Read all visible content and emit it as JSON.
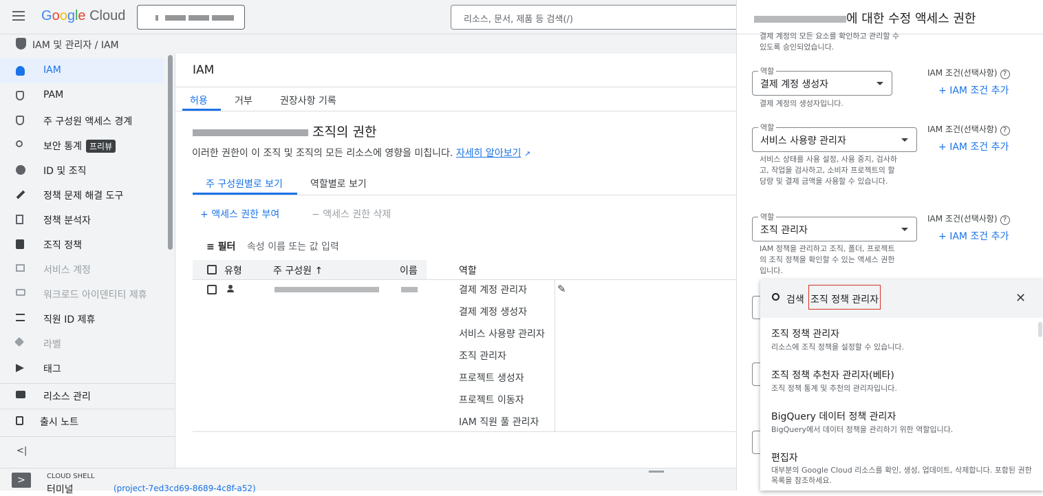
{
  "topbar": {
    "logo": "Google Cloud",
    "search_placeholder": "리소스, 문서, 제품 등 검색(/)"
  },
  "breadcrumb": {
    "text": "IAM 및 관리자  /  IAM"
  },
  "sidebar": {
    "items": [
      {
        "label": "IAM"
      },
      {
        "label": "PAM"
      },
      {
        "label": "주 구성원 액세스 경계"
      },
      {
        "label": "보안 통계",
        "badge": "프리뷰"
      },
      {
        "label": "ID 및 조직"
      },
      {
        "label": "정책 문제 해결 도구"
      },
      {
        "label": "정책 분석자"
      },
      {
        "label": "조직 정책"
      },
      {
        "label": "서비스 계정"
      },
      {
        "label": "워크로드 아이덴티티 제휴"
      },
      {
        "label": "직원 ID 제휴"
      },
      {
        "label": "라벨"
      },
      {
        "label": "태그"
      },
      {
        "label": "리소스 관리"
      },
      {
        "label": "출시 노트"
      }
    ],
    "collapse": "<|"
  },
  "main": {
    "title": "IAM",
    "tabs": [
      "허용",
      "거부",
      "권장사항 기록"
    ],
    "org_title": "조직의 권한",
    "desc": "이러한 권한이 이 조직 및 조직의 모든 리소스에 영향을 미칩니다.",
    "learn_more": "자세히 알아보기",
    "view_tabs": [
      "주 구성원별로 보기",
      "역할별로 보기"
    ],
    "grant": "액세스 권한 부여",
    "remove": "액세스 권한 삭제",
    "filter_label": "필터",
    "filter_placeholder": "속성 이름 또는 값 입력",
    "columns": [
      "유형",
      "주 구성원",
      "이름",
      "역할"
    ],
    "roles": [
      "결제 계정 관리자",
      "결제 계정 생성자",
      "서비스 사용량 관리자",
      "조직 관리자",
      "프로젝트 생성자",
      "프로젝트 이동자",
      "IAM 직원 풀 관리자"
    ]
  },
  "shell": {
    "label": "CLOUD SHELL",
    "terminal": "터미널",
    "project": "(project-7ed3cd69-8689-4c8f-a52)"
  },
  "panel": {
    "title_suffix": "에 대한 수정 액세스 권한",
    "top_desc": "결제 계정의 모든 요소를 확인하고 관리할 수 있도록 승인되었습니다.",
    "role_legend": "역할",
    "cond_label": "IAM 조건(선택사항)",
    "add_cond": "IAM 조건 추가",
    "roles": [
      {
        "value": "결제 계정 생성자",
        "desc": "결제 계정의 생성자입니다."
      },
      {
        "value": "서비스 사용량 관리자",
        "desc": "서비스 상태를 사용 설정, 사용 중지, 검사하고, 작업을 검사하고, 소비자 프로젝트의 할당량 및 결제 금액을 사용할 수 있습니다."
      },
      {
        "value": "조직 관리자",
        "desc": "IAM 정책을 관리하고 조직, 폴더, 프로젝트의 조직 정책을 확인할 수 있는 액세스 권한입니다."
      }
    ]
  },
  "dropdown": {
    "search_label": "검색",
    "search_value": "조직 정책 관리자",
    "options": [
      {
        "title": "조직 정책 관리자",
        "desc": "리소스에 조직 정책을 설정할 수 있습니다."
      },
      {
        "title": "조직 정책 추천자 관리자(베타)",
        "desc": "조직 정책 통계 및 추천의 관리자입니다."
      },
      {
        "title": "BigQuery 데이터 정책 관리자",
        "desc": "BigQuery에서 데이터 정책을 관리하기 위한 역할입니다."
      },
      {
        "title": "편집자",
        "desc": "대부분의 Google Cloud 리소스를 확인, 생성, 업데이트, 삭제합니다. 포함된 권한 목록을 참조하세요."
      }
    ]
  }
}
